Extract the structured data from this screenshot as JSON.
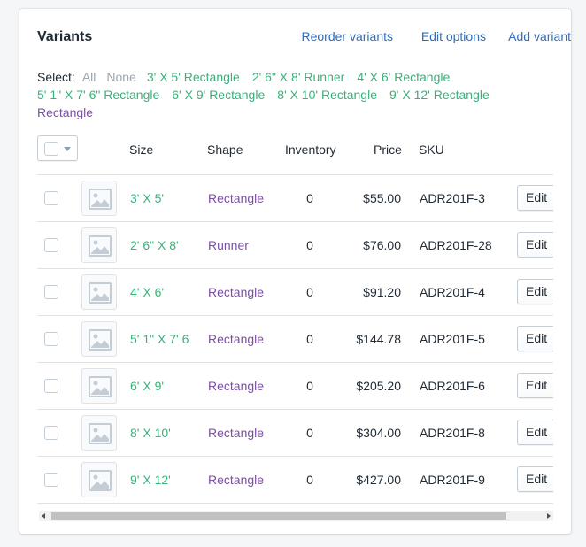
{
  "card": {
    "title": "Variants",
    "actions": {
      "reorder": "Reorder variants",
      "edit_options": "Edit options",
      "add_variant": "Add variant"
    }
  },
  "select": {
    "label": "Select:",
    "all": "All",
    "none": "None",
    "options": [
      "3' X 5' Rectangle",
      "2' 6\" X 8' Runner",
      "4' X 6' Rectangle",
      "5' 1\" X 7' 6\" Rectangle",
      "6' X 9' Rectangle",
      "8' X 10' Rectangle",
      "9' X 12' Rectangle",
      "Rectangle"
    ]
  },
  "table": {
    "headers": {
      "size": "Size",
      "shape": "Shape",
      "inventory": "Inventory",
      "price": "Price",
      "sku": "SKU"
    },
    "edit_label": "Edit",
    "rows": [
      {
        "size": "3' X 5'",
        "shape": "Rectangle",
        "inventory": "0",
        "price": "$55.00",
        "sku": "ADR201F-3"
      },
      {
        "size": "2' 6\" X 8'",
        "shape": "Runner",
        "inventory": "0",
        "price": "$76.00",
        "sku": "ADR201F-28"
      },
      {
        "size": "4' X 6'",
        "shape": "Rectangle",
        "inventory": "0",
        "price": "$91.20",
        "sku": "ADR201F-4"
      },
      {
        "size": "5' 1\" X 7' 6",
        "shape": "Rectangle",
        "inventory": "0",
        "price": "$144.78",
        "sku": "ADR201F-5"
      },
      {
        "size": "6' X 9'",
        "shape": "Rectangle",
        "inventory": "0",
        "price": "$205.20",
        "sku": "ADR201F-6"
      },
      {
        "size": "8' X 10'",
        "shape": "Rectangle",
        "inventory": "0",
        "price": "$304.00",
        "sku": "ADR201F-8"
      },
      {
        "size": "9' X 12'",
        "shape": "Rectangle",
        "inventory": "0",
        "price": "$427.00",
        "sku": "ADR201F-9"
      }
    ]
  },
  "colors": {
    "link_blue": "#2e6cc0",
    "option_green": "#37b279",
    "option_purple": "#7d4ea7",
    "muted": "#9ca6af"
  },
  "icons": {
    "thumbnail": "image-placeholder-icon",
    "bulk_caret": "chevron-down-icon"
  }
}
